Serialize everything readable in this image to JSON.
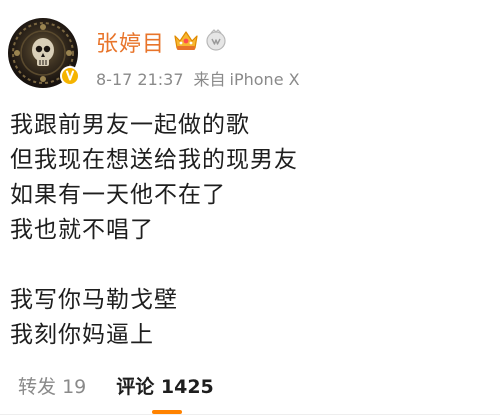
{
  "post": {
    "author": {
      "name": "张婷目",
      "avatar": "skull-avatar",
      "badges": [
        "crown-icon",
        "vip-badge-icon"
      ],
      "verified": "verified-badge-icon"
    },
    "meta": {
      "time": "8-17 21:37",
      "source_label": "来自",
      "device": "iPhone X"
    },
    "lines": [
      "我跟前男友一起做的歌",
      "但我现在想送给我的现男友",
      "如果有一天他不在了",
      "我也就不唱了",
      "",
      "我写你马勒戈壁",
      "我刻你妈逼上"
    ],
    "footer": {
      "repost_label": "转发",
      "repost_count": "19",
      "comment_label": "评论",
      "comment_count": "1425"
    }
  },
  "colors": {
    "username": "#e8742a",
    "meta_gray": "#8a8a8a",
    "accent": "#ff8200",
    "verified": "#f5b400"
  }
}
